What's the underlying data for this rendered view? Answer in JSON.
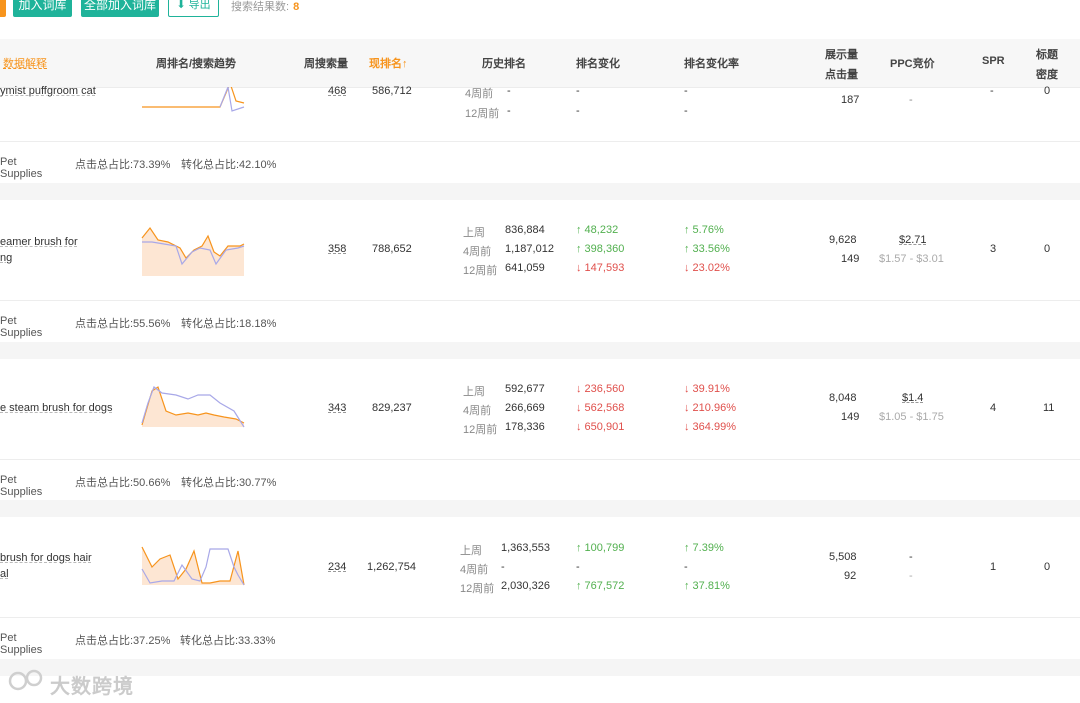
{
  "toolbar": {
    "add_label": "加入词库",
    "add_all_label": "全部加入词库",
    "export_label": "导出",
    "result_label": "搜索结果数:",
    "result_count": "8"
  },
  "table": {
    "headers": {
      "data_explain": "数据解释",
      "trend": "周排名/搜索趋势",
      "weekly_volume": "周搜索量",
      "current_rank": "现排名↑",
      "history": "历史排名",
      "rank_change": "排名变化",
      "rank_change_rate": "排名变化率",
      "impressions": "展示量",
      "clicks": "点击量",
      "ppc": "PPC竞价",
      "spr": "SPR",
      "title_density_1": "标题",
      "title_density_2": "密度"
    },
    "period_labels": {
      "last_week": "上周",
      "four_weeks": "4周前",
      "twelve_weeks": "12周前"
    },
    "rows": [
      {
        "keyword_lines": [
          "ymist puffgroom cat"
        ],
        "weekly_volume": "468",
        "current_rank": "586,712",
        "hist_4w": "-",
        "hist_12w": "-",
        "chg_4w": "-",
        "chg_12w": "-",
        "rate_4w": "-",
        "rate_12w": "-",
        "clicks": "187",
        "ppc": "-",
        "spr": "-",
        "density": "0",
        "category": "Pet Supplies",
        "click_share": "点击总占比:73.39%",
        "conv_share": "转化总占比:42.10%"
      },
      {
        "keyword_lines": [
          "eamer brush for",
          "ng"
        ],
        "weekly_volume": "358",
        "current_rank": "788,652",
        "hist_lw": "836,884",
        "hist_4w": "1,187,012",
        "hist_12w": "641,059",
        "chg_lw": "↑ 48,232",
        "chg_4w": "↑ 398,360",
        "chg_12w": "↓ 147,593",
        "rate_lw": "↑ 5.76%",
        "rate_4w": "↑ 33.56%",
        "rate_12w": "↓ 23.02%",
        "impressions": "9,628",
        "clicks": "149",
        "ppc": "$2.71",
        "ppc_range": "$1.57 - $3.01",
        "spr": "3",
        "density": "0",
        "category": "Pet Supplies",
        "click_share": "点击总占比:55.56%",
        "conv_share": "转化总占比:18.18%"
      },
      {
        "keyword_lines": [
          "e steam brush for dogs"
        ],
        "weekly_volume": "343",
        "current_rank": "829,237",
        "hist_lw": "592,677",
        "hist_4w": "266,669",
        "hist_12w": "178,336",
        "chg_lw": "↓ 236,560",
        "chg_4w": "↓ 562,568",
        "chg_12w": "↓ 650,901",
        "rate_lw": "↓ 39.91%",
        "rate_4w": "↓ 210.96%",
        "rate_12w": "↓ 364.99%",
        "impressions": "8,048",
        "clicks": "149",
        "ppc": "$1.4",
        "ppc_range": "$1.05 - $1.75",
        "spr": "4",
        "density": "11",
        "category": "Pet Supplies",
        "click_share": "点击总占比:50.66%",
        "conv_share": "转化总占比:30.77%"
      },
      {
        "keyword_lines": [
          "brush for dogs hair",
          "al"
        ],
        "weekly_volume": "234",
        "current_rank": "1,262,754",
        "hist_lw": "1,363,553",
        "hist_4w": "-",
        "hist_12w": "2,030,326",
        "chg_lw": "↑ 100,799",
        "chg_4w": "-",
        "chg_12w": "↑ 767,572",
        "rate_lw": "↑ 7.39%",
        "rate_4w": "-",
        "rate_12w": "↑ 37.81%",
        "impressions": "5,508",
        "clicks": "92",
        "ppc": "-",
        "ppc_range": "-",
        "spr": "1",
        "density": "0",
        "category": "Pet Supplies",
        "click_share": "点击总占比:37.25%",
        "conv_share": "转化总占比:33.33%"
      }
    ]
  },
  "more_glyph": "⋮",
  "watermark": "大数跨境",
  "colors": {
    "accent_green": "#1fb39a",
    "accent_orange": "#f7941d",
    "up": "#52b04f",
    "down": "#e0504c"
  }
}
